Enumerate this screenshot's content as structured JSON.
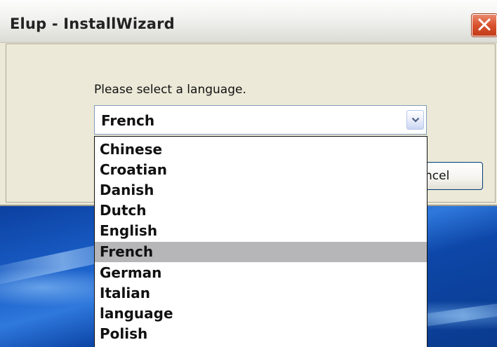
{
  "window": {
    "title": "Elup - InstallWizard",
    "close_icon": "close-icon"
  },
  "dialog": {
    "prompt": "Please select a language.",
    "cancel_label": "ncel"
  },
  "language_select": {
    "selected": "French",
    "options": [
      "Chinese",
      "Croatian",
      "Danish",
      "Dutch",
      "English",
      "French",
      "German",
      "Italian",
      "language",
      "Polish"
    ],
    "highlighted_index": 5
  },
  "colors": {
    "highlight": "#b6b6b9",
    "close_button": "#d9522e"
  }
}
